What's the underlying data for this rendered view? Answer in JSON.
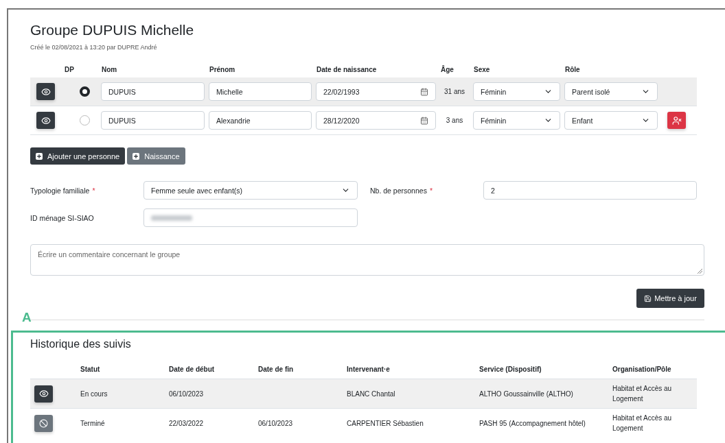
{
  "title": "Groupe DUPUIS Michelle",
  "subtitle": "Créé le 02/08/2021 à 13:20 par DUPRE André",
  "people": {
    "columns": [
      "DP",
      "Nom",
      "Prénom",
      "Date de naissance",
      "Âge",
      "Sexe",
      "Rôle"
    ],
    "rows": [
      {
        "selected": true,
        "nom": "DUPUIS",
        "prenom": "Michelle",
        "date": "22/02/1993",
        "age": "31 ans",
        "sexe": "Féminin",
        "role": "Parent isolé",
        "removable": false
      },
      {
        "selected": false,
        "nom": "DUPUIS",
        "prenom": "Alexandrie",
        "date": "28/12/2020",
        "age": "3 ans",
        "sexe": "Féminin",
        "role": "Enfant",
        "removable": true
      }
    ]
  },
  "actions": [
    {
      "label": "Ajouter une personne",
      "kind": "primary"
    },
    {
      "label": "Naissance",
      "kind": "secondary"
    }
  ],
  "form": {
    "typologie": {
      "label": "Typologie familiale",
      "required_mark": "*",
      "value": "Femme seule avec enfant(s)"
    },
    "nb": {
      "label": "Nb. de personnes",
      "required_mark": "*",
      "value": "2"
    },
    "id_menage": {
      "label": "ID ménage SI-SIAO",
      "redacted": true
    },
    "comment": {
      "placeholder": "Écrire un commentaire concernant le groupe"
    },
    "submit": "Mettre à jour"
  },
  "annotation": {
    "label": "A",
    "color": "#4cbb8f"
  },
  "history": {
    "title": "Historique des suivis",
    "columns": [
      "Statut",
      "Date de début",
      "Date de fin",
      "Intervenant·e",
      "Service (Dispositif)",
      "Organisation/Pôle"
    ],
    "rows": [
      {
        "active": true,
        "cells": [
          "En cours",
          "06/10/2023",
          "",
          "BLANC Chantal",
          "ALTHO Goussainville (ALTHO)",
          "Habitat et Accès au Logement"
        ]
      },
      {
        "active": false,
        "cells": [
          "Terminé",
          "22/03/2022",
          "06/10/2023",
          "CARPENTIER Sébastien",
          "PASH 95 (Accompagnement hôtel)",
          "Habitat et Accès au Logement"
        ]
      }
    ]
  }
}
